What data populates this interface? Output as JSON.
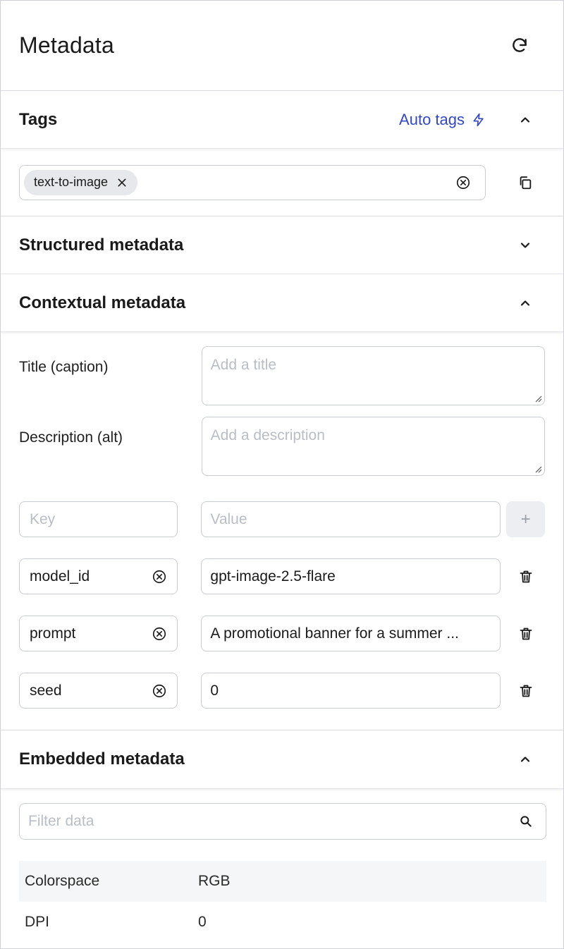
{
  "header": {
    "title": "Metadata",
    "refresh_icon": "refresh-icon"
  },
  "tags": {
    "title": "Tags",
    "auto_tags_label": "Auto tags",
    "chips": [
      {
        "label": "text-to-image"
      }
    ]
  },
  "structured": {
    "title": "Structured metadata"
  },
  "contextual": {
    "title": "Contextual metadata",
    "title_field": {
      "label": "Title (caption)",
      "placeholder": "Add a title"
    },
    "description_field": {
      "label": "Description (alt)",
      "placeholder": "Add a description"
    },
    "new_pair": {
      "key_placeholder": "Key",
      "value_placeholder": "Value",
      "add_label": "+"
    },
    "pairs": [
      {
        "key": "model_id",
        "value": "gpt-image-2.5-flare"
      },
      {
        "key": "prompt",
        "value": "A promotional banner for a summer ..."
      },
      {
        "key": "seed",
        "value": "0"
      }
    ]
  },
  "embedded": {
    "title": "Embedded metadata",
    "filter_placeholder": "Filter data",
    "rows": [
      {
        "key": "Colorspace",
        "value": "RGB"
      },
      {
        "key": "DPI",
        "value": "0"
      }
    ]
  },
  "colors": {
    "accent": "#3347c9",
    "border": "#c9ccd2",
    "chip_bg": "#e7e8ec"
  }
}
